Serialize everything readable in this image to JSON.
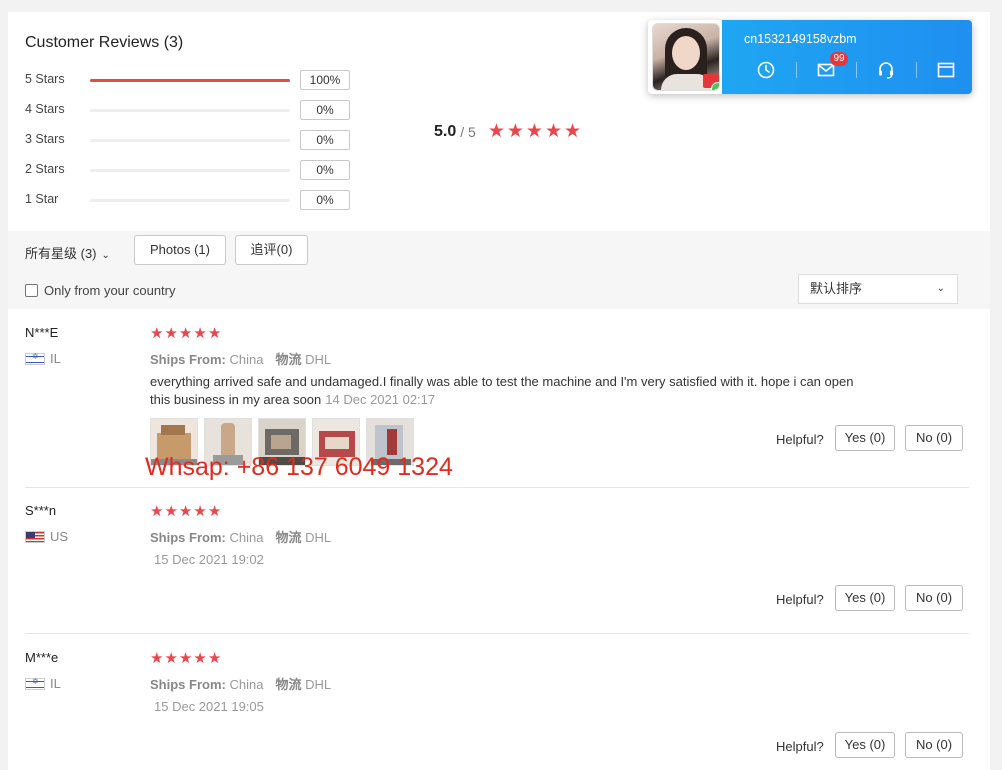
{
  "title": "Customer Reviews (3)",
  "histogram": [
    {
      "label": "5 Stars",
      "pct_text": "100%",
      "fraction": 1.0
    },
    {
      "label": "4 Stars",
      "pct_text": "0%",
      "fraction": 0
    },
    {
      "label": "3 Stars",
      "pct_text": "0%",
      "fraction": 0
    },
    {
      "label": "2 Stars",
      "pct_text": "0%",
      "fraction": 0
    },
    {
      "label": "1 Star",
      "pct_text": "0%",
      "fraction": 0
    }
  ],
  "average": {
    "score": "5.0",
    "total": "/ 5",
    "stars": 5
  },
  "filters": {
    "all_ratings": "所有星级 (3)",
    "photos": "Photos (1)",
    "followup": "追评(0)",
    "only_country": "Only from your country",
    "sort": "默认排序"
  },
  "reviews": [
    {
      "name": "N***E",
      "country": "IL",
      "stars": 5,
      "ships_from_label": "Ships From:",
      "ships_from": "China",
      "logistics_label": "物流",
      "logistics": "DHL",
      "text": "everything arrived safe and undamaged.I finally was able to test the machine and I'm very satisfied with it. hope i can open this business in my area soon",
      "date": "14 Dec 2021 02:17",
      "photo_count": 5,
      "helpful_label": "Helpful?",
      "yes_label": "Yes (0)",
      "no_label": "No (0)"
    },
    {
      "name": "S***n",
      "country": "US",
      "stars": 5,
      "ships_from_label": "Ships From:",
      "ships_from": "China",
      "logistics_label": "物流",
      "logistics": "DHL",
      "date": "15 Dec 2021 19:02",
      "helpful_label": "Helpful?",
      "yes_label": "Yes (0)",
      "no_label": "No (0)"
    },
    {
      "name": "M***e",
      "country": "IL",
      "stars": 5,
      "ships_from_label": "Ships From:",
      "ships_from": "China",
      "logistics_label": "物流",
      "logistics": "DHL",
      "date": "15 Dec 2021 19:05",
      "helpful_label": "Helpful?",
      "yes_label": "Yes (0)",
      "no_label": "No (0)"
    }
  ],
  "watermark": "Whsap: +86 137 6049 1324",
  "chat": {
    "username": "cn1532149158vzbm",
    "message_count": "99",
    "icons": [
      "clock-icon",
      "mail-icon",
      "headset-icon",
      "window-icon"
    ]
  },
  "colors": {
    "star": "#e8474d",
    "chat_bg": "#1f9af2",
    "watermark": "#e02b20"
  }
}
